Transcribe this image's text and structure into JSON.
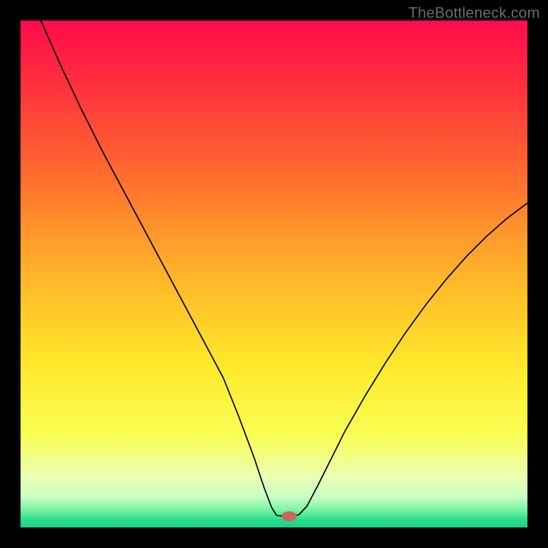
{
  "watermark": "TheBottleneck.com",
  "chart_data": {
    "type": "line",
    "title": "",
    "xlabel": "",
    "ylabel": "",
    "xlim": [
      0,
      100
    ],
    "ylim": [
      0,
      100
    ],
    "grid": false,
    "gradient_stops": [
      {
        "offset": 0.0,
        "color": "#ff0b4a"
      },
      {
        "offset": 0.12,
        "color": "#ff2e3e"
      },
      {
        "offset": 0.3,
        "color": "#ff6a2f"
      },
      {
        "offset": 0.5,
        "color": "#ffb429"
      },
      {
        "offset": 0.68,
        "color": "#ffe82a"
      },
      {
        "offset": 0.82,
        "color": "#f9ff55"
      },
      {
        "offset": 0.9,
        "color": "#eaffb4"
      },
      {
        "offset": 0.94,
        "color": "#c9ffc4"
      },
      {
        "offset": 0.965,
        "color": "#7bf3a6"
      },
      {
        "offset": 0.985,
        "color": "#29dd8b"
      },
      {
        "offset": 1.0,
        "color": "#1fcf85"
      }
    ],
    "marker": {
      "x": 53,
      "y": 2.2,
      "rx": 1.5,
      "ry": 1.0,
      "fill": "#c7695a"
    },
    "series": [
      {
        "name": "curve",
        "stroke": "#000000",
        "stroke_width": 1.8,
        "points": [
          {
            "x": 4.0,
            "y": 100.0
          },
          {
            "x": 8.0,
            "y": 91.0
          },
          {
            "x": 12.0,
            "y": 82.5
          },
          {
            "x": 16.0,
            "y": 74.5
          },
          {
            "x": 20.0,
            "y": 67.0
          },
          {
            "x": 24.0,
            "y": 59.5
          },
          {
            "x": 28.0,
            "y": 52.0
          },
          {
            "x": 32.0,
            "y": 44.5
          },
          {
            "x": 36.0,
            "y": 37.0
          },
          {
            "x": 40.0,
            "y": 29.5
          },
          {
            "x": 43.0,
            "y": 22.0
          },
          {
            "x": 46.0,
            "y": 14.0
          },
          {
            "x": 48.0,
            "y": 8.0
          },
          {
            "x": 49.5,
            "y": 4.0
          },
          {
            "x": 50.5,
            "y": 2.4
          },
          {
            "x": 52.0,
            "y": 2.2
          },
          {
            "x": 54.0,
            "y": 2.2
          },
          {
            "x": 55.0,
            "y": 2.6
          },
          {
            "x": 56.5,
            "y": 4.2
          },
          {
            "x": 58.5,
            "y": 8.0
          },
          {
            "x": 61.0,
            "y": 13.0
          },
          {
            "x": 64.0,
            "y": 19.0
          },
          {
            "x": 68.0,
            "y": 26.0
          },
          {
            "x": 72.0,
            "y": 32.5
          },
          {
            "x": 76.0,
            "y": 38.5
          },
          {
            "x": 80.0,
            "y": 44.0
          },
          {
            "x": 84.0,
            "y": 49.0
          },
          {
            "x": 88.0,
            "y": 53.5
          },
          {
            "x": 92.0,
            "y": 57.5
          },
          {
            "x": 96.0,
            "y": 61.0
          },
          {
            "x": 100.0,
            "y": 64.0
          }
        ]
      }
    ]
  }
}
